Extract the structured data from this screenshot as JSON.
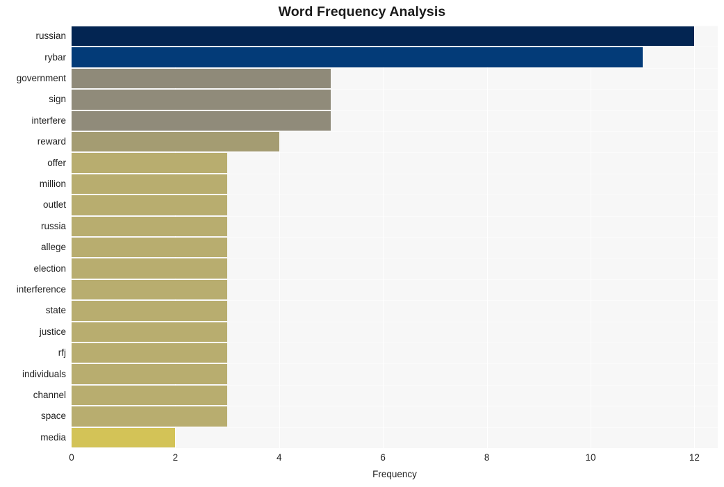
{
  "chart_data": {
    "type": "bar",
    "orientation": "horizontal",
    "title": "Word Frequency Analysis",
    "xlabel": "Frequency",
    "ylabel": "",
    "xlim": [
      0,
      12.45
    ],
    "xticks": [
      0,
      2,
      4,
      6,
      8,
      10,
      12
    ],
    "xtick_labels": [
      "0",
      "2",
      "4",
      "6",
      "8",
      "10",
      "12"
    ],
    "grid": true,
    "grid_axis": "both",
    "legend": false,
    "plot_bgcolor": "#f7f7f7",
    "figure_bgcolor": "#ffffff",
    "categories": [
      "russian",
      "rybar",
      "government",
      "sign",
      "interfere",
      "reward",
      "offer",
      "million",
      "outlet",
      "russia",
      "allege",
      "election",
      "interference",
      "state",
      "justice",
      "rfj",
      "individuals",
      "channel",
      "space",
      "media"
    ],
    "values": [
      12,
      11,
      5,
      5,
      5,
      4,
      3,
      3,
      3,
      3,
      3,
      3,
      3,
      3,
      3,
      3,
      3,
      3,
      3,
      2
    ],
    "bar_colors": [
      "#032552",
      "#033b78",
      "#8f8a79",
      "#908b7a",
      "#908b7a",
      "#a49c72",
      "#b8ad6f",
      "#b8ad6f",
      "#b8ad6f",
      "#b8ad6f",
      "#b8ad6f",
      "#b8ad6f",
      "#b8ad6f",
      "#b8ad6f",
      "#b8ad6f",
      "#b8ad6f",
      "#b8ad6f",
      "#b8ad6f",
      "#b8ad6f",
      "#d3c357"
    ]
  }
}
